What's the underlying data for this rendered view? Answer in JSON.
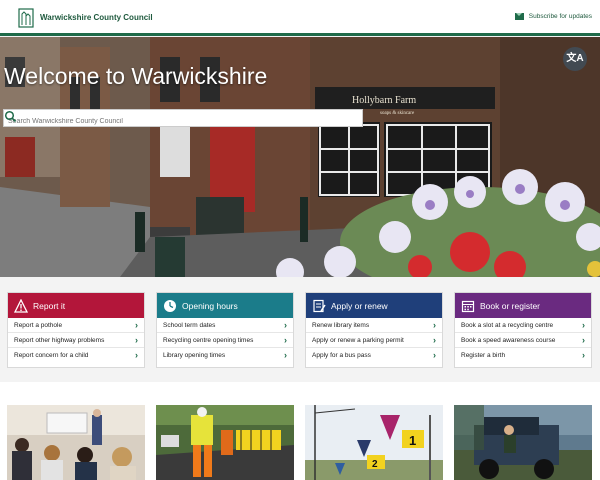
{
  "header": {
    "site_name": "Warwickshire County Council",
    "subscribe_label": "Subscribe for updates"
  },
  "hero": {
    "title": "Welcome to Warwickshire",
    "search_placeholder": "Search Warwickshire County Council",
    "translate_label": "文A",
    "shop_sign": "Hollybarn Farm",
    "shop_sub": "soaps & skincare"
  },
  "cards": [
    {
      "title": "Report it",
      "color": "#b3163a",
      "icon": "warning-icon",
      "links": [
        "Report a pothole",
        "Report other highway problems",
        "Report concern for a child"
      ]
    },
    {
      "title": "Opening hours",
      "color": "#1b7c8a",
      "icon": "clock-icon",
      "links": [
        "School term dates",
        "Recycling centre opening times",
        "Library opening times"
      ]
    },
    {
      "title": "Apply or renew",
      "color": "#1f3f7a",
      "icon": "form-icon",
      "links": [
        "Renew library items",
        "Apply or renew a parking permit",
        "Apply for a bus pass"
      ]
    },
    {
      "title": "Book or register",
      "color": "#6a2a80",
      "icon": "calendar-icon",
      "links": [
        "Book a slot at a recycling centre",
        "Book a speed awareness course",
        "Register a birth"
      ]
    }
  ],
  "thumbs": [
    "classroom-photo",
    "roadworks-photo",
    "signs-photo",
    "utility-vehicle-photo"
  ]
}
